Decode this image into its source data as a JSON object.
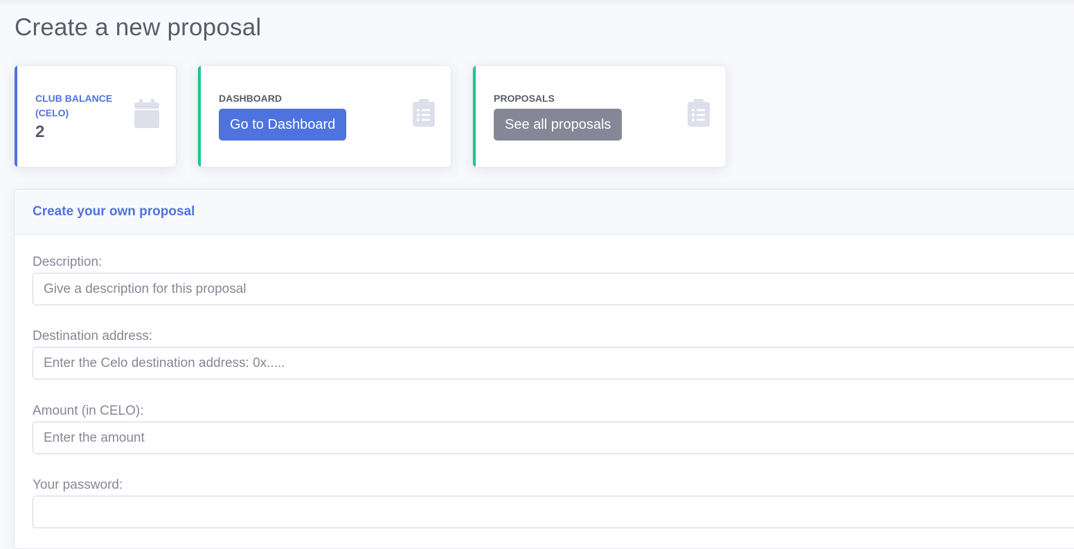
{
  "page": {
    "title": "Create a new proposal"
  },
  "cards": {
    "balance": {
      "label": "CLUB BALANCE (CELO)",
      "value": "2",
      "icon": "calendar-icon",
      "accent": "#4e73df"
    },
    "dashboard": {
      "label": "DASHBOARD",
      "button_label": "Go to Dashboard",
      "icon": "clipboard-list-icon",
      "accent": "#1cc88a"
    },
    "proposals": {
      "label": "PROPOSALS",
      "button_label": "See all proposals",
      "icon": "clipboard-list-icon",
      "accent": "#1cc88a"
    }
  },
  "form": {
    "title": "Create your own proposal",
    "description": {
      "label": "Description:",
      "placeholder": "Give a description for this proposal",
      "value": ""
    },
    "destination": {
      "label": "Destination address:",
      "placeholder": "Enter the Celo destination address: 0x.....",
      "value": ""
    },
    "amount": {
      "label": "Amount (in CELO):",
      "placeholder": "Enter the amount",
      "value": ""
    },
    "password": {
      "label": "Your password:",
      "placeholder": "",
      "value": ""
    }
  },
  "colors": {
    "primary": "#4e73df",
    "success": "#1cc88a",
    "secondary": "#858796",
    "background": "#f8f9fc"
  }
}
